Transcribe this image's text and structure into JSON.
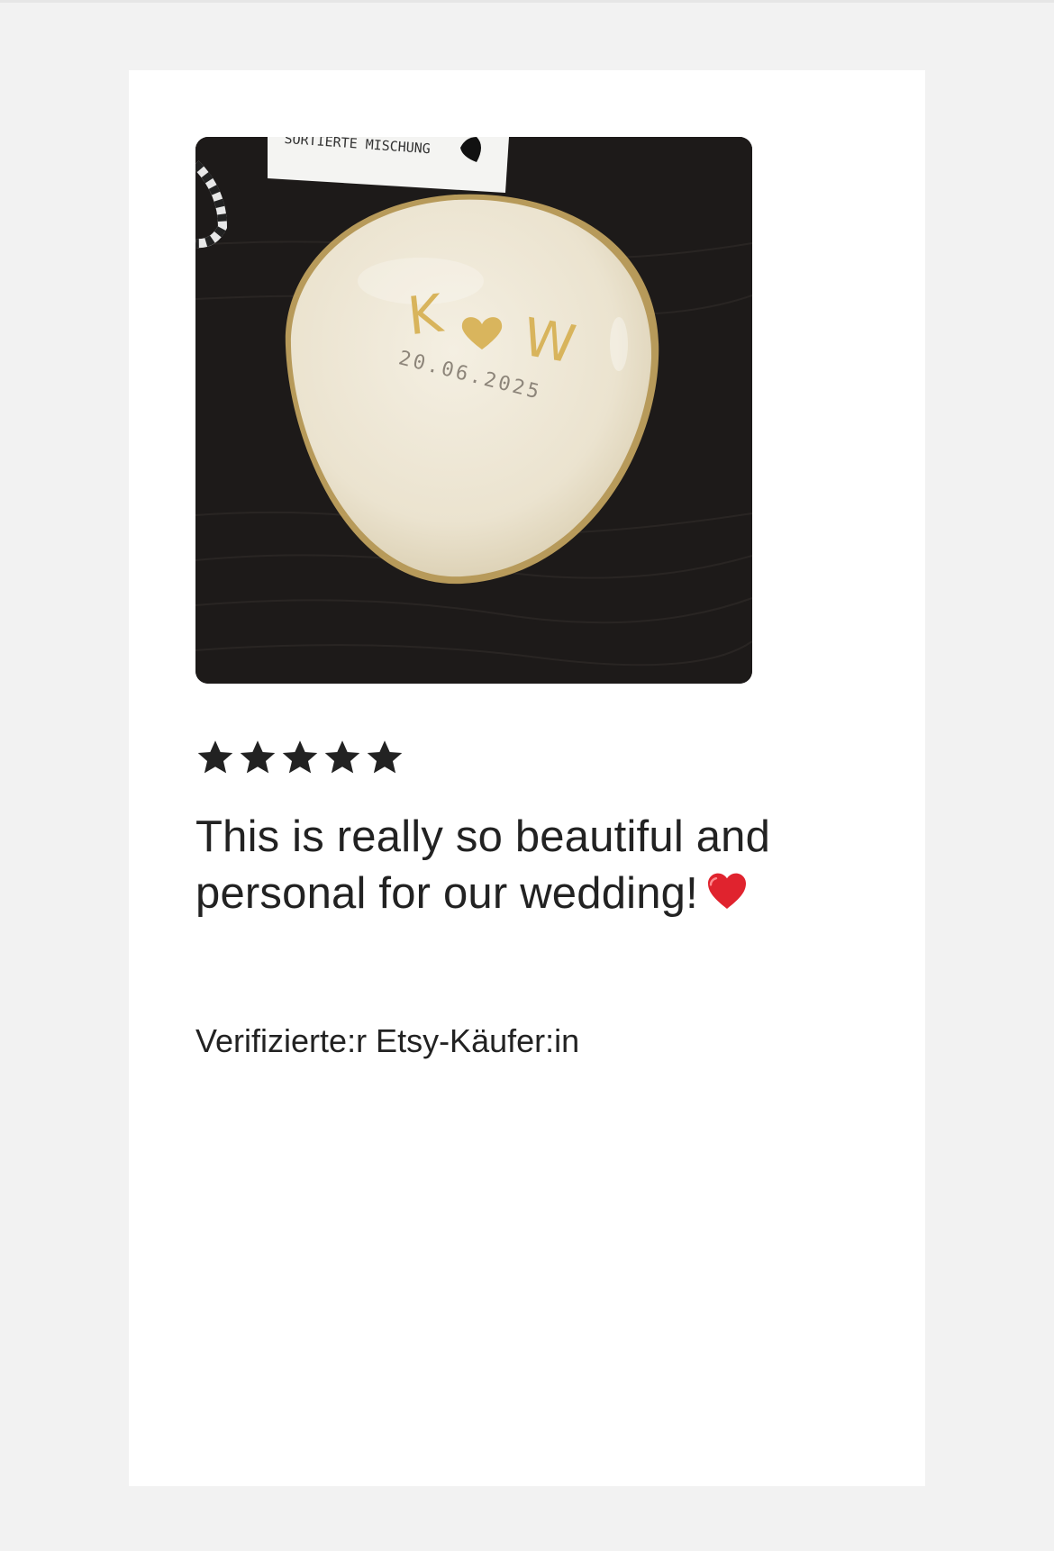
{
  "review": {
    "rating": 5,
    "rating_max": 5,
    "text": "This is really so beautiful and personal for our wedding!",
    "emoji": "heart-emoji",
    "reviewer_label": "Verifizierte:r Etsy-Käufer:in"
  },
  "photo": {
    "tag_text": "SORTIERTE MISCHUNG",
    "plate_initials_left": "K",
    "plate_initials_right": "W",
    "plate_date": "20.06.2025"
  },
  "colors": {
    "page_background": "#f2f2f2",
    "card_background": "#ffffff",
    "text": "#222222",
    "star": "#222222",
    "heart": "#e0232e",
    "gold": "#d8b45c"
  }
}
